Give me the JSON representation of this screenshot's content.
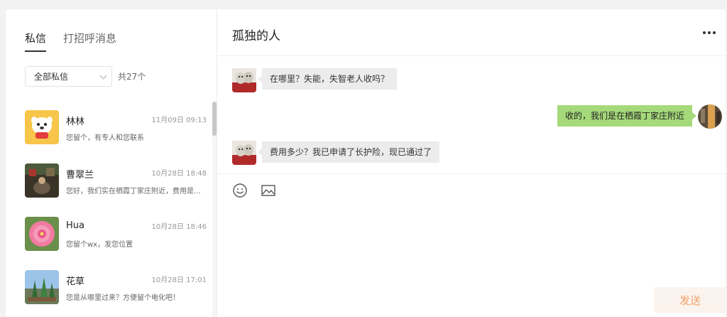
{
  "sidebar": {
    "tabs": [
      {
        "label": "私信",
        "active": true
      },
      {
        "label": "打招呼消息",
        "active": false
      }
    ],
    "filter": {
      "selected": "全部私信",
      "count_text": "共27个"
    },
    "conversations": [
      {
        "name": "林林",
        "time": "11月09日 09:13",
        "preview": "您留个，有专人和您联系",
        "avatar": "cartoon-dog-avatar"
      },
      {
        "name": "曹翠兰",
        "time": "10月28日 18:48",
        "preview": "您好，我们实在栖霞丁家庄附近，费用是...",
        "avatar": "photo-avatar"
      },
      {
        "name": "Hua",
        "time": "10月28日 18:46",
        "preview": "您留个wx，发您位置",
        "avatar": "pink-flower-avatar"
      },
      {
        "name": "花草",
        "time": "10月28日 17:01",
        "preview": "您是从哪里过来？方便留个电化吧！",
        "avatar": "plants-avatar"
      }
    ]
  },
  "chat": {
    "title": "孤独的人",
    "messages": [
      {
        "from": "other",
        "text": "在哪里？失能，失智老人收吗？"
      },
      {
        "from": "me",
        "text": "收的，我们是在栖霞丁家庄附近"
      },
      {
        "from": "other",
        "text": "费用多少？我已申请了长护险，现已通过了"
      }
    ],
    "toolbar": [
      "emoji-icon",
      "image-icon"
    ],
    "send_label": "发送"
  },
  "colors": {
    "my_bubble": "#a5d97a",
    "other_bubble": "#ececec",
    "send_text": "#f3a36b",
    "send_bg": "#fbf3ed"
  }
}
